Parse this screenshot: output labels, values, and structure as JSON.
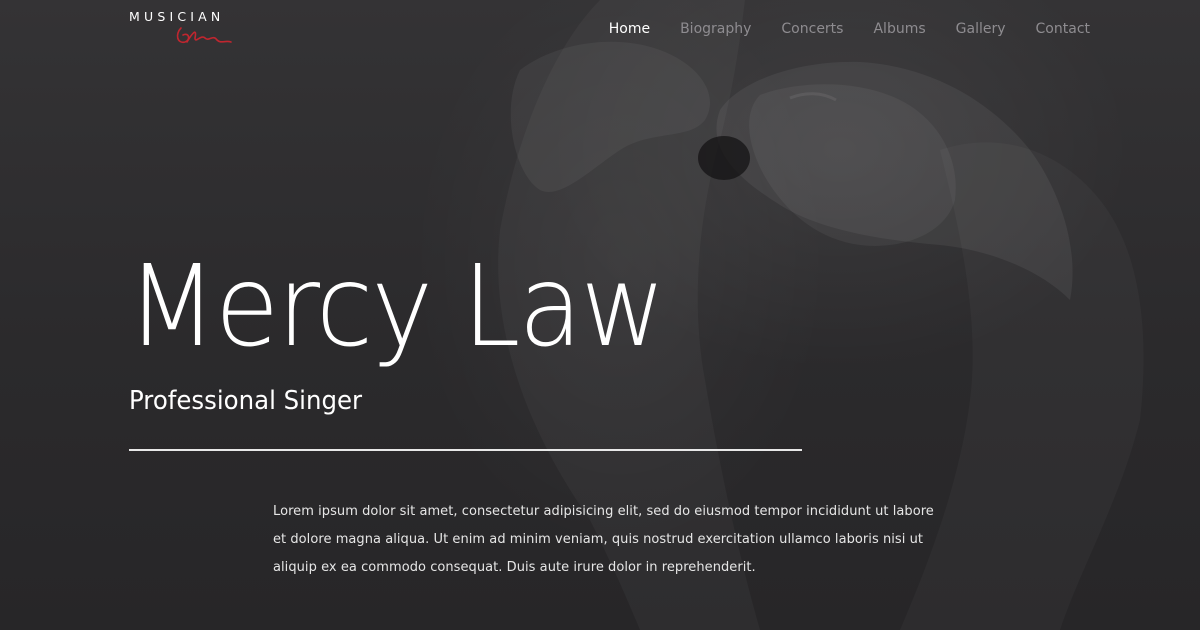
{
  "brand": {
    "logo_text": "MUSICIAN",
    "accent_color": "#c0262f"
  },
  "nav": {
    "items": [
      {
        "label": "Home",
        "active": true
      },
      {
        "label": "Biography",
        "active": false
      },
      {
        "label": "Concerts",
        "active": false
      },
      {
        "label": "Albums",
        "active": false
      },
      {
        "label": "Gallery",
        "active": false
      },
      {
        "label": "Contact",
        "active": false
      }
    ]
  },
  "hero": {
    "title": "Mercy Law",
    "subtitle": "Professional Singer",
    "intro": "Lorem ipsum dolor sit amet, consectetur adipisicing elit, sed do eiusmod tempor incididunt ut labore et dolore magna aliqua. Ut enim ad minim veniam, quis nostrud exercitation ullamco laboris nisi ut aliquip ex ea commodo consequat. Duis aute irure dolor in reprehenderit."
  },
  "colors": {
    "background": "#2a292b",
    "text": "#ffffff",
    "nav_inactive": "#8e8c90"
  }
}
